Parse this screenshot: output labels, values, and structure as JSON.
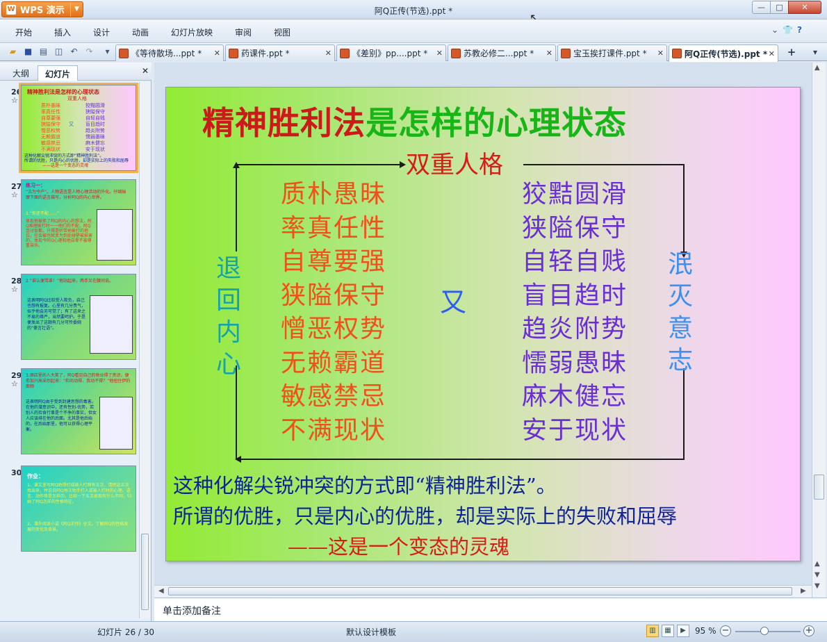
{
  "window": {
    "app_button": "WPS 演示",
    "title": "阿Q正传(节选).ppt *",
    "controls": {
      "minimize": "—",
      "maximize": "□",
      "close": "✕"
    }
  },
  "menu": {
    "items": [
      "开始",
      "插入",
      "设计",
      "动画",
      "幻灯片放映",
      "审阅",
      "视图"
    ],
    "right_icons": [
      "chevron-down",
      "shirt",
      "help"
    ]
  },
  "tabs": [
    {
      "label": "《等待散场...ppt *",
      "active": false
    },
    {
      "label": "药课件.ppt *",
      "active": false
    },
    {
      "label": "《差别》pp....ppt *",
      "active": false
    },
    {
      "label": "苏教必修二...ppt *",
      "active": false
    },
    {
      "label": "宝玉挨打课件.ppt *",
      "active": false
    },
    {
      "label": "阿Q正传(节选).ppt *",
      "active": true
    }
  ],
  "tab_add": "+",
  "tab_list": "▾",
  "left_panel": {
    "tabs": [
      "大纲",
      "幻灯片"
    ],
    "active_tab": "幻灯片",
    "close": "✕",
    "thumbnails": [
      {
        "num": "26",
        "selected": true,
        "title": "精神胜利法是怎样的心理状态",
        "sub": "双重人格",
        "left_col": [
          "质朴愚昧",
          "率真任性",
          "自尊要强",
          "狭隘保守",
          "憎恶权势",
          "无赖霸道",
          "敏感禁忌",
          "不满现状"
        ],
        "right_col": [
          "狡黠圆滑",
          "狭隘保守",
          "自轻自贱",
          "盲目趋时",
          "趋炎附势",
          "懦弱愚昧",
          "麻木健忘",
          "安于现状"
        ],
        "you": "又",
        "bottom1": "这种化解尖锐冲突的方式即“精神胜利法”。",
        "bottom2": "所谓的优胜，只是内心的优胜，却是实际上的失败和屈辱",
        "bottom3": "——这是一个变态的灵魂"
      },
      {
        "num": "27",
        "selected": false,
        "heading": "练习一：",
        "line1": "“古为今产”。人物语言是人物心理活动的外化。仔细揣摩下面的语言描写，分析阿Q的内心世界。",
        "line2": "1.“你还不配……”",
        "line3": "体现他被抓了阿Q的内心的想法，阿Q难理挨打时一一他们的不配，阿Q连讨饭都，只得是听带地挨打的地位，往会被也就变为到处碰壁被损害的，体现今阿Q心理和他自卑不被尊重自乐。"
      },
      {
        "num": "28",
        "selected": false,
        "heading": "2.“谁认便骂谁！”他站起来，两手叉在腰间说。",
        "body": "这表明阿Q比较受人欺负，自己也想有报复。心里有几分畏气，似乎他会另可觉了；有了这来之不易的尊严，当然要呵护。于是便发出了这颇有几分可怜委婉的“豪言壮语”。"
      },
      {
        "num": "29",
        "selected": false,
        "heading": "3.酒店里的人大笑了，阿Q看见自己的勃业得了赏识，便愈加兴高采烈起来：“和尚动得，我动不得？”他扭住伊的面颊",
        "body": "这表明阿Q由于受到封建思想的毒害。在他的潜意识中，还有性别-优势，若别人的捡食行事是个不争的事实，但女人应该排在他的后面。尤其是他后始的，在后始那里，他可以获得心理平衡。"
      },
      {
        "num": "30",
        "selected": false,
        "heading": "作业：",
        "line1": "1、课文里写阿Q劝得打成被人打两有五次，请把这五次找出来，并说说阿Q每次劝手打人或被人打时的心理、语言、动作等是怎样的，比较一下五次表现有什么不同，归纳了阿Q怎样的性格特征。",
        "line2": "2、课外阅读小说《阿Q正传》全文，了解阿Q的性格发展的变化及背景。"
      }
    ]
  },
  "slide": {
    "title_red": "精神胜利法",
    "title_green": "是怎样的心理状态",
    "subtitle": "双重人格",
    "left_vertical": "退回内心",
    "right_vertical": "泯灭意志",
    "left_col": [
      "质朴愚昧",
      "率真任性",
      "自尊要强",
      "狭隘保守",
      "憎恶权势",
      "无赖霸道",
      "敏感禁忌",
      "不满现状"
    ],
    "right_col": [
      "狡黠圆滑",
      "狭隘保守",
      "自轻自贱",
      "盲目趋时",
      "趋炎附势",
      "懦弱愚昧",
      "麻木健忘",
      "安于现状"
    ],
    "middle": "又",
    "conclusion": [
      "这种化解尖锐冲突的方式即“精神胜利法”。",
      "所谓的优胜，只是内心的优胜，却是实际上的失败和屈辱",
      "——这是一个变态的灵魂"
    ],
    "colors": {
      "title_red": "#cc1a1a",
      "title_green": "#17b515",
      "subtitle": "#d81b16",
      "left_col": "#f2501a",
      "right_col": "#6a2ed6",
      "left_vertical": "#16a3a8",
      "right_vertical": "#3d8ff0",
      "middle": "#2c5ef0",
      "conclusion": "#0d2396",
      "conclusion_last": "#d81b16"
    }
  },
  "notes": {
    "placeholder": "单击添加备注"
  },
  "status": {
    "slide_info": "幻灯片 26 / 30",
    "template": "默认设计模板",
    "zoom": "95 %",
    "zoom_level": 0.45
  }
}
